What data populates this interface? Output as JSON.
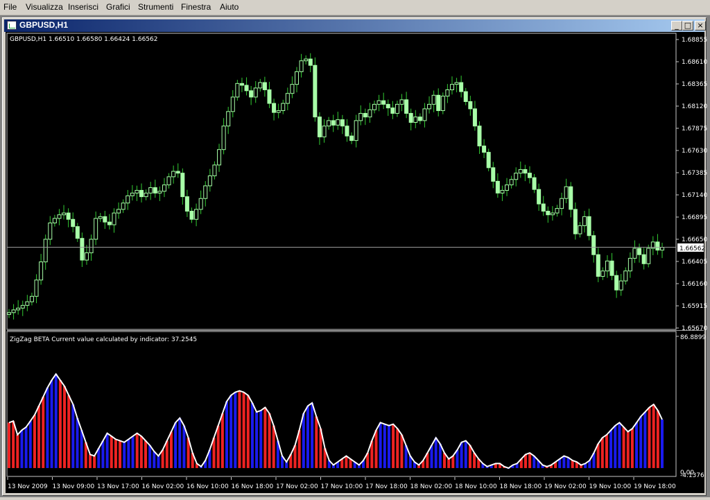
{
  "menu": {
    "file": "File",
    "visualizza": "Visualizza",
    "inserisci": "Inserisci",
    "grafici": "Grafici",
    "strumenti": "Strumenti",
    "finestra": "Finestra",
    "aiuto": "Aiuto"
  },
  "window": {
    "title": "GBPUSD,H1",
    "minimize": "_",
    "restore": "□",
    "close": "×"
  },
  "main_chart": {
    "info": "GBPUSD,H1  1.66510 1.66580 1.66424 1.66562",
    "bid_label": "1.66562",
    "price_ticks": [
      "1.68855",
      "1.68610",
      "1.68365",
      "1.68120",
      "1.67875",
      "1.67630",
      "1.67385",
      "1.67140",
      "1.66895",
      "1.66650",
      "1.66405",
      "1.66160",
      "1.65915",
      "1.65670"
    ],
    "time_ticks": [
      "13 Nov 2009",
      "13 Nov 09:00",
      "13 Nov 17:00",
      "16 Nov 02:00",
      "16 Nov 10:00",
      "16 Nov 18:00",
      "17 Nov 02:00",
      "17 Nov 10:00",
      "17 Nov 18:00",
      "18 Nov 02:00",
      "18 Nov 10:00",
      "18 Nov 18:00",
      "19 Nov 02:00",
      "19 Nov 10:00",
      "19 Nov 18:00"
    ]
  },
  "indicator": {
    "label": "ZigZag BETA Current value calculated by indicator: 37.2545",
    "top_tick": "86.8899",
    "zero_tick": "0.00",
    "bottom_tick": "-4.1376"
  },
  "colors": {
    "background": "#000000",
    "candle": "#a8ffa8",
    "wick": "#33cc33",
    "bar_red": "#ee2222",
    "bar_blue": "#1a1aee",
    "zigzag": "#ffffff",
    "bid_line": "#9a9a9a"
  },
  "chart_data": [
    {
      "type": "candlestick",
      "title": "GBPUSD,H1",
      "ylim": [
        1.6567,
        1.69
      ],
      "x": [
        "13 Nov 2009",
        "13 Nov 09:00",
        "13 Nov 17:00",
        "16 Nov 02:00",
        "16 Nov 10:00",
        "16 Nov 18:00",
        "17 Nov 02:00",
        "17 Nov 10:00",
        "17 Nov 18:00",
        "18 Nov 02:00",
        "18 Nov 10:00",
        "18 Nov 18:00",
        "19 Nov 02:00",
        "19 Nov 10:00",
        "19 Nov 18:00"
      ],
      "closes": [
        1.6584,
        1.6587,
        1.6589,
        1.6592,
        1.6596,
        1.6602,
        1.662,
        1.664,
        1.6665,
        1.6683,
        1.6688,
        1.6692,
        1.6694,
        1.6687,
        1.6679,
        1.6666,
        1.6642,
        1.665,
        1.6665,
        1.6688,
        1.669,
        1.6684,
        1.6681,
        1.6694,
        1.6698,
        1.6705,
        1.6713,
        1.6716,
        1.6719,
        1.6712,
        1.6716,
        1.6722,
        1.6716,
        1.6718,
        1.6725,
        1.6734,
        1.674,
        1.6738,
        1.6712,
        1.6696,
        1.6687,
        1.6698,
        1.671,
        1.6724,
        1.6735,
        1.6747,
        1.6764,
        1.679,
        1.6806,
        1.6822,
        1.6837,
        1.6835,
        1.6829,
        1.6822,
        1.6832,
        1.6838,
        1.683,
        1.6815,
        1.6805,
        1.6807,
        1.6815,
        1.6826,
        1.6836,
        1.685,
        1.6862,
        1.6864,
        1.6857,
        1.68,
        1.6778,
        1.679,
        1.6796,
        1.6791,
        1.6797,
        1.679,
        1.6779,
        1.6774,
        1.6796,
        1.6804,
        1.68,
        1.6808,
        1.6814,
        1.6818,
        1.6814,
        1.681,
        1.6804,
        1.6814,
        1.6819,
        1.6804,
        1.6794,
        1.68,
        1.6796,
        1.6809,
        1.6814,
        1.6824,
        1.6807,
        1.6823,
        1.683,
        1.6836,
        1.6838,
        1.6828,
        1.6817,
        1.6809,
        1.679,
        1.6768,
        1.6761,
        1.6744,
        1.6729,
        1.6716,
        1.6719,
        1.6725,
        1.6731,
        1.6738,
        1.6742,
        1.6738,
        1.6733,
        1.672,
        1.6704,
        1.6696,
        1.6692,
        1.6694,
        1.6699,
        1.671,
        1.6723,
        1.6698,
        1.6671,
        1.668,
        1.669,
        1.6669,
        1.6648,
        1.6624,
        1.663,
        1.6641,
        1.6625,
        1.6609,
        1.6619,
        1.663,
        1.6644,
        1.6655,
        1.6648,
        1.6638,
        1.6655,
        1.6662,
        1.6653,
        1.6656
      ]
    },
    {
      "type": "bar",
      "title": "ZigZag BETA",
      "ylim": [
        -4.1376,
        86.8899
      ],
      "values": [
        30,
        31,
        22,
        25,
        27,
        31,
        35,
        41,
        47,
        53,
        58,
        62,
        58,
        54,
        48,
        42,
        33,
        25,
        17,
        9,
        8,
        13,
        18,
        23,
        21,
        19,
        18,
        17,
        19,
        21,
        23,
        21,
        18,
        15,
        11,
        8,
        12,
        18,
        24,
        30,
        33,
        28,
        20,
        10,
        3,
        1,
        5,
        12,
        20,
        28,
        36,
        44,
        48,
        50,
        51,
        50,
        48,
        43,
        37,
        38,
        40,
        36,
        28,
        18,
        8,
        4,
        9,
        15,
        25,
        36,
        41,
        43,
        34,
        26,
        13,
        5,
        2,
        4,
        6,
        8,
        6,
        4,
        2,
        5,
        10,
        18,
        25,
        30,
        29,
        28,
        29,
        26,
        22,
        15,
        8,
        4,
        2,
        5,
        10,
        15,
        20,
        16,
        10,
        6,
        8,
        12,
        17,
        18,
        15,
        10,
        6,
        3,
        1,
        2,
        3,
        3,
        1,
        0,
        2,
        3,
        6,
        9,
        10,
        8,
        5,
        2,
        1,
        2,
        4,
        6,
        8,
        7,
        5,
        4,
        2,
        3,
        5,
        10,
        16,
        20,
        22,
        25,
        28,
        30,
        27,
        24,
        26,
        30,
        34,
        37,
        40,
        42,
        38,
        32
      ]
    }
  ]
}
